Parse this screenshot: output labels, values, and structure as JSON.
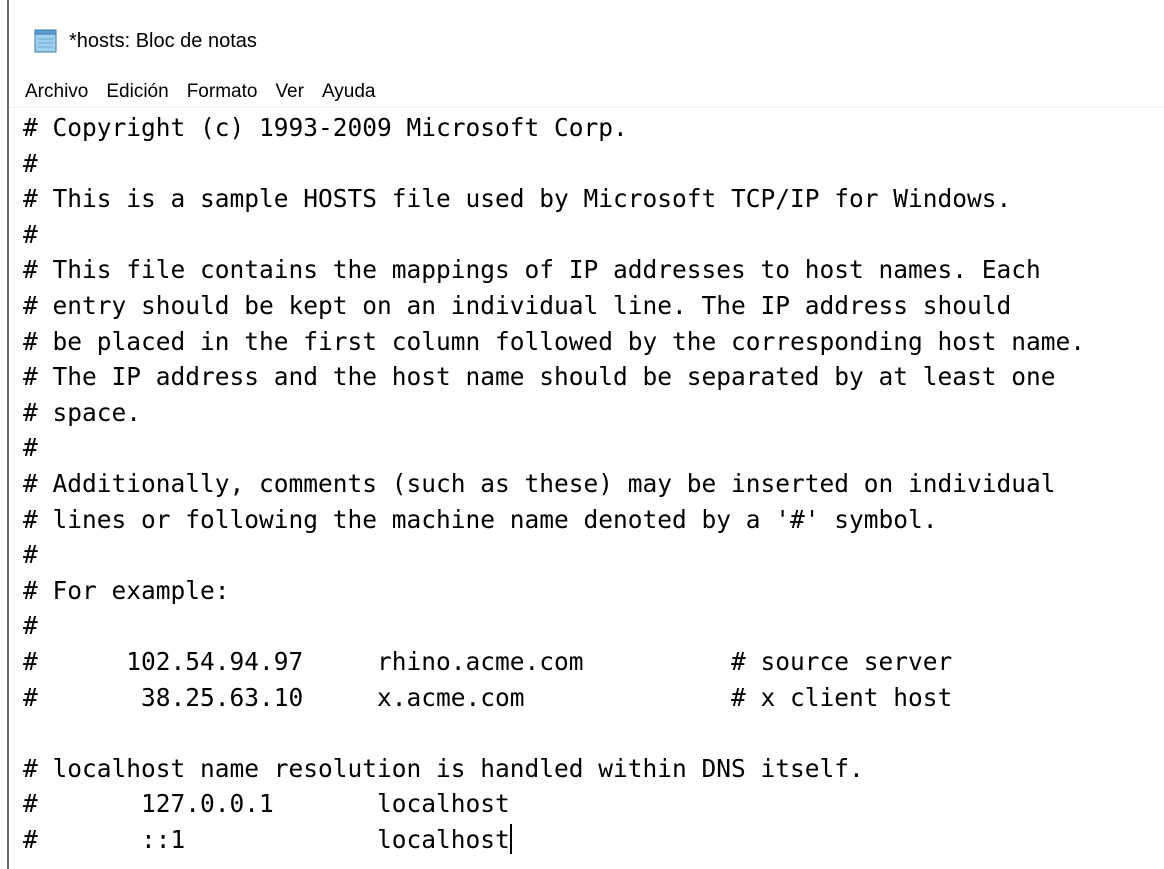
{
  "window": {
    "title": "*hosts: Bloc de notas",
    "app_icon": "notepad-icon"
  },
  "menu": [
    "Archivo",
    "Edición",
    "Formato",
    "Ver",
    "Ayuda"
  ],
  "editor": {
    "lines": [
      "# Copyright (c) 1993-2009 Microsoft Corp.",
      "#",
      "# This is a sample HOSTS file used by Microsoft TCP/IP for Windows.",
      "#",
      "# This file contains the mappings of IP addresses to host names. Each",
      "# entry should be kept on an individual line. The IP address should",
      "# be placed in the first column followed by the corresponding host name.",
      "# The IP address and the host name should be separated by at least one",
      "# space.",
      "#",
      "# Additionally, comments (such as these) may be inserted on individual",
      "# lines or following the machine name denoted by a '#' symbol.",
      "#",
      "# For example:",
      "#",
      "#      102.54.94.97     rhino.acme.com          # source server",
      "#       38.25.63.10     x.acme.com              # x client host",
      "",
      "# localhost name resolution is handled within DNS itself.",
      "#\t127.0.0.1       localhost",
      "#\t::1             localhost"
    ]
  }
}
